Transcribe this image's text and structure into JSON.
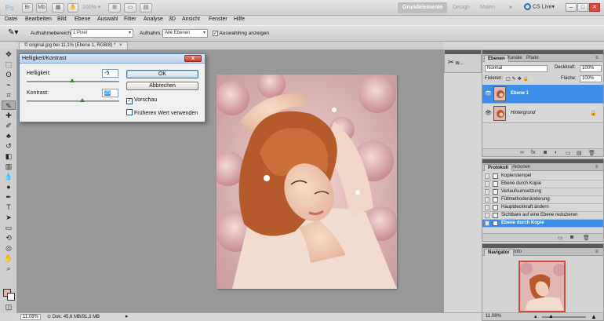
{
  "app": {
    "logo": "Ps",
    "zoom": "100%",
    "workspaces": [
      "Grundelemente",
      "Design",
      "Malen"
    ],
    "active_workspace": "Grundelemente",
    "more": "»",
    "cslive": "CS Live▾"
  },
  "menu": [
    "Datei",
    "Bearbeiten",
    "Bild",
    "Ebene",
    "Auswahl",
    "Filter",
    "Analyse",
    "3D",
    "Ansicht",
    "Fenster",
    "Hilfe"
  ],
  "options": {
    "sample_size_label": "Aufnahmebereich:",
    "sample_size_value": "1 Pixel",
    "sample_label": "Aufnahm.:",
    "sample_value": "Alle Ebenen",
    "show_ring_label": "Auswahlring anzeigen"
  },
  "document": {
    "tab_title": "© original.jpg bei 11,1% (Ebene 1, RGB/8) *",
    "close": "×"
  },
  "status": {
    "zoom": "11,08%",
    "doc_info": "Dok: 45,6 MB/91,3 MB"
  },
  "dialog": {
    "title": "Helligkeit/Kontrast",
    "brightness_label": "Helligkeit:",
    "brightness_value": "-5",
    "contrast_label": "Kontrast:",
    "contrast_value": "25",
    "ok": "OK",
    "cancel": "Abbrechen",
    "preview": "Vorschau",
    "legacy": "Früheren Wert verwenden"
  },
  "icon_strip": {
    "label": "w..."
  },
  "layers_panel": {
    "tabs": [
      "Ebenen",
      "Kanäle",
      "Pfade"
    ],
    "blend_mode": "Normal",
    "opacity_label": "Deckkraft:",
    "opacity_value": "100%",
    "lock_label": "Fixieren:",
    "fill_label": "Fläche:",
    "fill_value": "100%",
    "layers": [
      {
        "name": "Ebene 1",
        "active": true
      },
      {
        "name": "Hintergrund",
        "active": false
      }
    ]
  },
  "history_panel": {
    "tabs": [
      "Protokoll",
      "Aktionen"
    ],
    "items": [
      {
        "label": "Kopierstempel",
        "active": false
      },
      {
        "label": "Ebene durch Kopie",
        "active": false
      },
      {
        "label": "Verlaufsumsetzung",
        "active": false
      },
      {
        "label": "Füllmethodenänderung",
        "active": false
      },
      {
        "label": "Hauptdeckkraft ändern",
        "active": false
      },
      {
        "label": "Sichtbare auf eine Ebene reduzieren",
        "active": false
      },
      {
        "label": "Ebene durch Kopie",
        "active": true
      }
    ]
  },
  "navigator_panel": {
    "tabs": [
      "Navigator",
      "Info"
    ],
    "zoom": "11,08%"
  }
}
